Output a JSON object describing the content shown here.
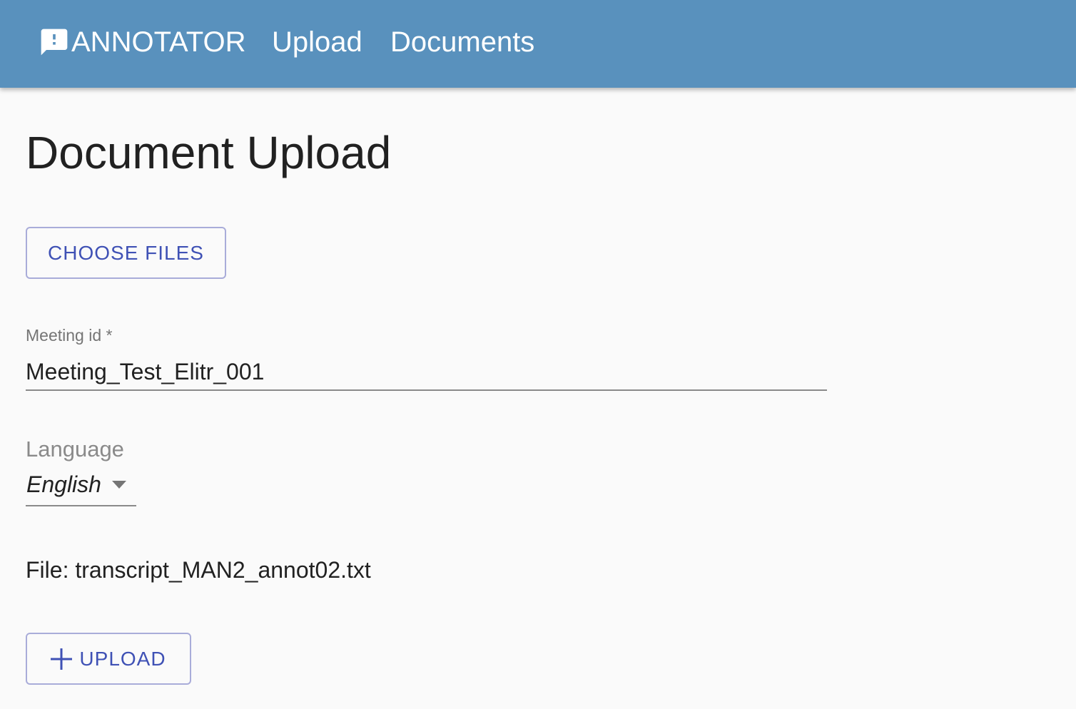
{
  "app": {
    "brand_label": "ANNOTATOR",
    "brand_icon": "feedback-icon",
    "nav": {
      "upload_label": "Upload",
      "documents_label": "Documents"
    },
    "colors": {
      "appbar": "#5991bd",
      "primary": "#3f51b5",
      "background": "#fafafa"
    }
  },
  "page": {
    "title": "Document Upload"
  },
  "form": {
    "choose_files_label": "CHOOSE FILES",
    "meeting_id": {
      "label": "Meeting id *",
      "value": "Meeting_Test_Elitr_001"
    },
    "language": {
      "label": "Language",
      "selected": "English",
      "icon": "arrow-drop-down-icon"
    },
    "file": {
      "prefix": "File: ",
      "name": "transcript_MAN2_annot02.txt"
    },
    "upload_label": "UPLOAD",
    "upload_icon": "plus-icon"
  }
}
